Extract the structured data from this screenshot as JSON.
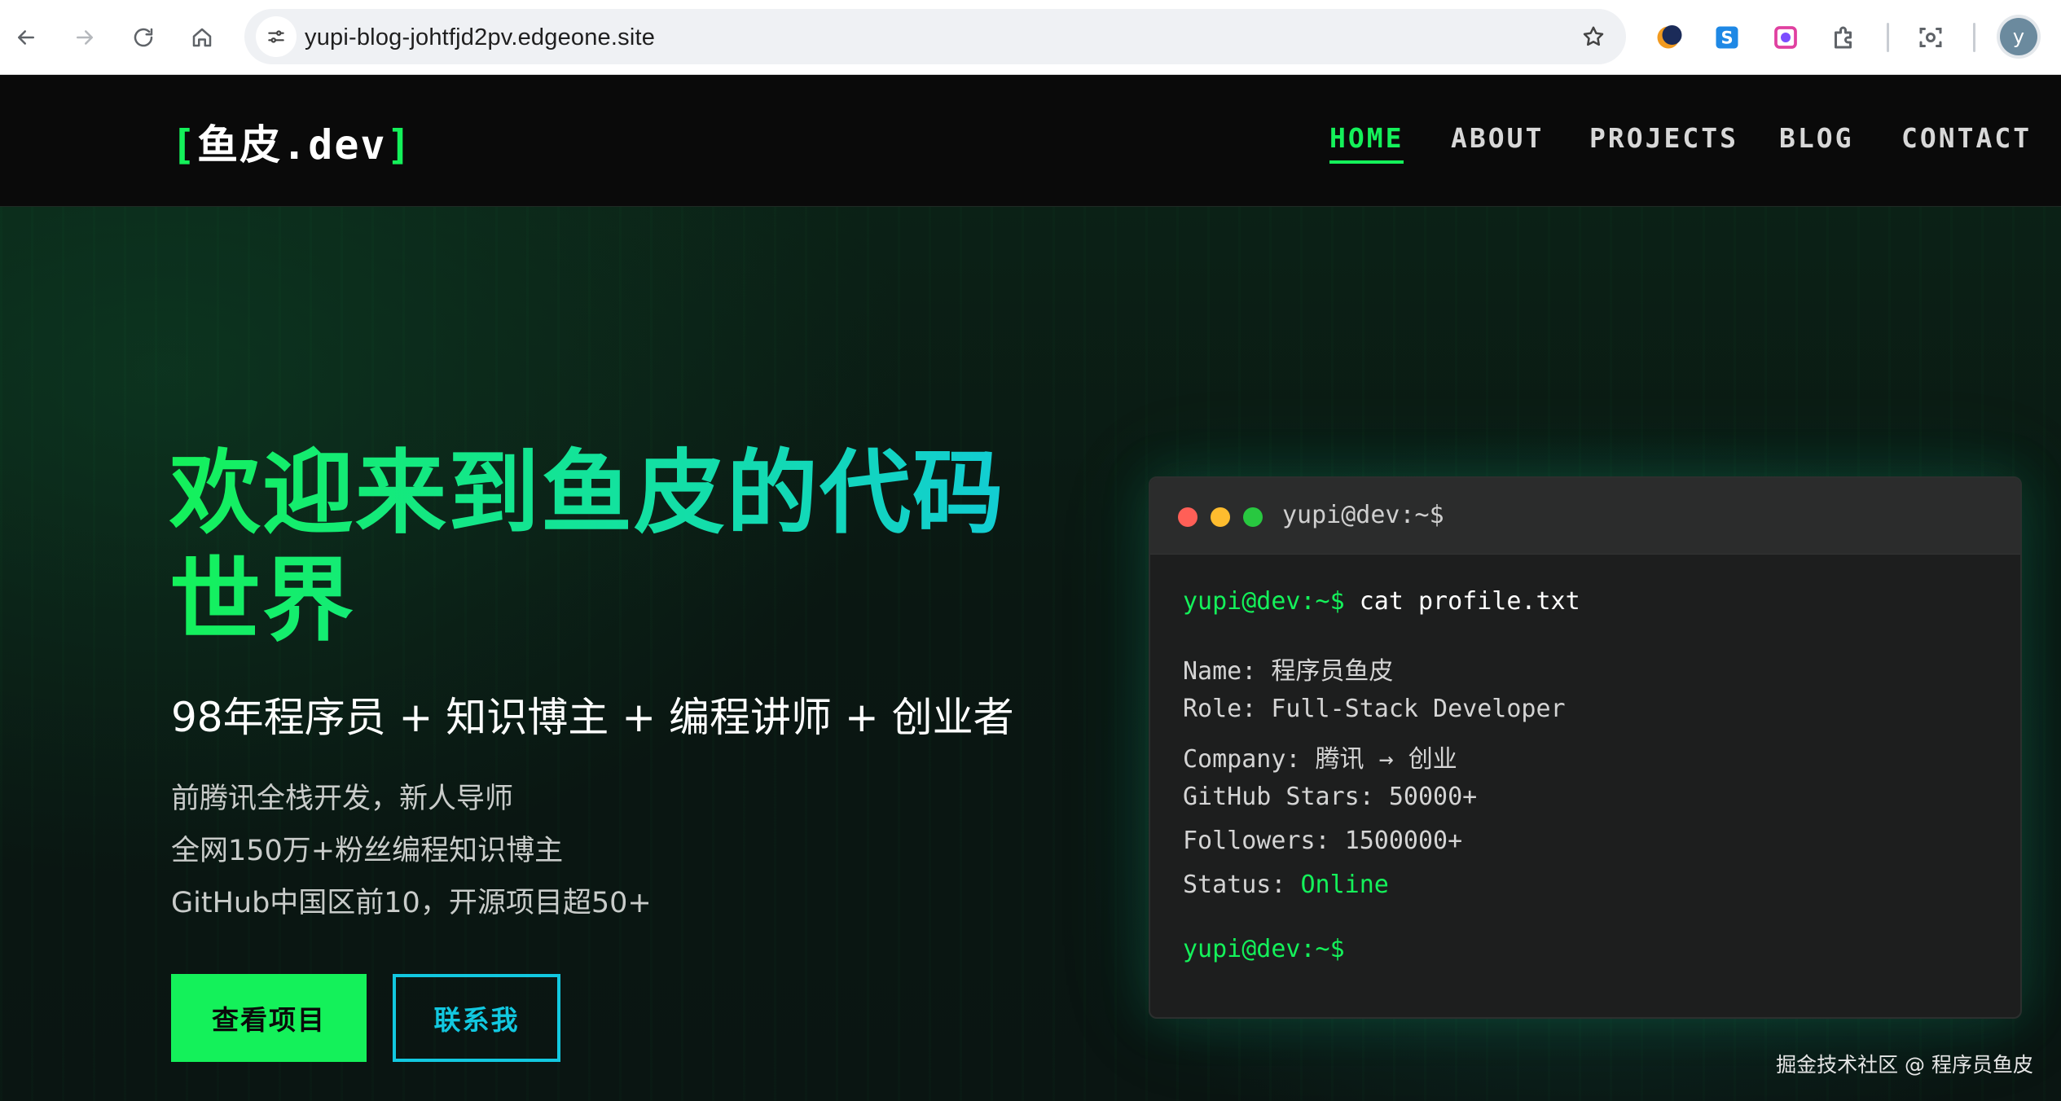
{
  "browser": {
    "url": "yupi-blog-johtfjd2pv.edgeone.site",
    "profile_initial": "y"
  },
  "site": {
    "logo": {
      "open": "[",
      "text": "鱼皮.dev",
      "close": "]"
    },
    "nav": [
      {
        "label": "HOME",
        "active": true
      },
      {
        "label": "ABOUT",
        "active": false
      },
      {
        "label": "PROJECTS",
        "active": false
      },
      {
        "label": "BLOG",
        "active": false
      },
      {
        "label": "CONTACT",
        "active": false
      }
    ]
  },
  "hero": {
    "title_line1": "欢迎来到鱼皮的代码",
    "title_line2": "世界",
    "subtitle": "98年程序员 + 知识博主 + 编程讲师 + 创业者",
    "lines": [
      "前腾讯全栈开发，新人导师",
      "全网150万+粉丝编程知识博主",
      "GitHub中国区前10，开源项目超50+"
    ],
    "primary_button": "查看项目",
    "secondary_button": "联系我"
  },
  "terminal": {
    "title": "yupi@dev:~$",
    "prompt": "yupi@dev:~$",
    "command": "cat profile.txt",
    "rows": [
      {
        "key": "Name:",
        "value": "程序员鱼皮"
      },
      {
        "key": "Role:",
        "value": "Full-Stack Developer"
      },
      {
        "key": "Company:",
        "value": "腾讯 → 创业"
      },
      {
        "key": "GitHub Stars:",
        "value": "50000+"
      },
      {
        "key": "Followers:",
        "value": "1500000+"
      },
      {
        "key": "Status:",
        "value": "Online"
      }
    ],
    "final_prompt": "yupi@dev:~$"
  },
  "watermark": "掘金技术社区 @ 程序员鱼皮",
  "colors": {
    "accent_green": "#14f15a",
    "accent_cyan": "#12c8e0",
    "header_bg": "#0a0a0a",
    "terminal_bg": "#1d1e1e"
  }
}
